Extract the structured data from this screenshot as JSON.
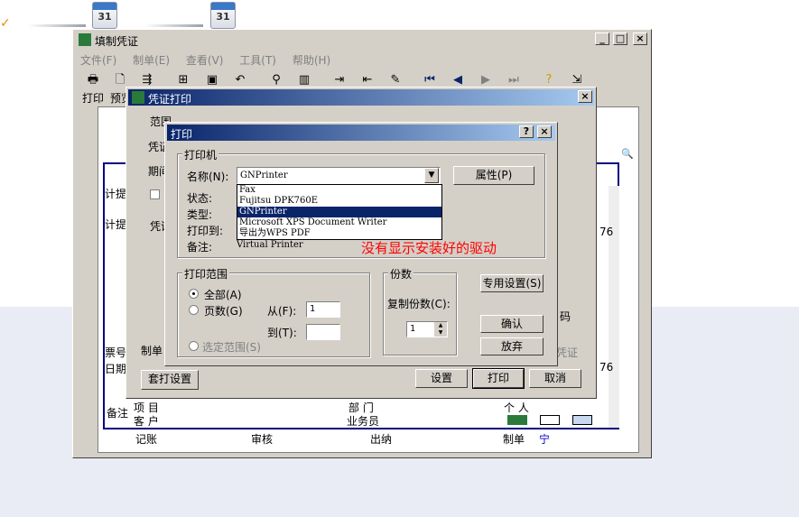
{
  "main_window": {
    "title": "填制凭证",
    "menu": [
      "文件(F)",
      "制单(E)",
      "查看(V)",
      "工具(T)",
      "帮助(H)"
    ],
    "toolbar_labels": [
      "打印",
      "预览"
    ],
    "left_labels": [
      "计提",
      "计提",
      "票号",
      "日期",
      "备注"
    ],
    "footer": {
      "l1": "项 目",
      "l2": "客 户",
      "l3": "部 门",
      "l4": "业务员",
      "l5": "个 人"
    },
    "signatures": [
      "记账",
      "审核",
      "出纳",
      "制单"
    ],
    "signer": "宁",
    "right_values": [
      "76",
      "76"
    ]
  },
  "voucher_print": {
    "title": "凭证打印",
    "range_label": "范围",
    "voucher_label": "凭证",
    "period_label": "期间",
    "group2_label": "凭证",
    "bottom_label": "制单",
    "right_label": "码",
    "right_label2": "凭证",
    "set_print_button": "套打设置"
  },
  "print_dialog": {
    "title": "打印",
    "printer_group": "打印机",
    "name_label": "名称(N):",
    "selected_printer": "GNPrinter",
    "properties_button": "属性(P)",
    "status_label": "状态:",
    "type_label": "类型:",
    "where_label": "打印到:",
    "comment_label": "备注:",
    "comment_value": "Virtual Printer",
    "printer_options": [
      "Fax",
      "Fujitsu DPK760E",
      "GNPrinter",
      "Microsoft XPS Document Writer",
      "导出为WPS PDF"
    ],
    "range_group": "打印范围",
    "all_label": "全部(A)",
    "pages_label": "页数(G)",
    "selection_label": "选定范围(S)",
    "from_label": "从(F):",
    "to_label": "到(T):",
    "from_value": "1",
    "copies_group": "份数",
    "copies_label": "复制份数(C):",
    "copies_value": "1",
    "special_button": "专用设置(S)",
    "ok_button": "确认",
    "cancel_button2": "放弃",
    "setup_button": "设置",
    "print_button": "打印",
    "cancel_button": "取消"
  },
  "annotation": "没有显示安装好的驱动",
  "colors": {
    "annotation": "#ff0000",
    "title_active": "#0a246a",
    "selection": "#0a246a"
  }
}
